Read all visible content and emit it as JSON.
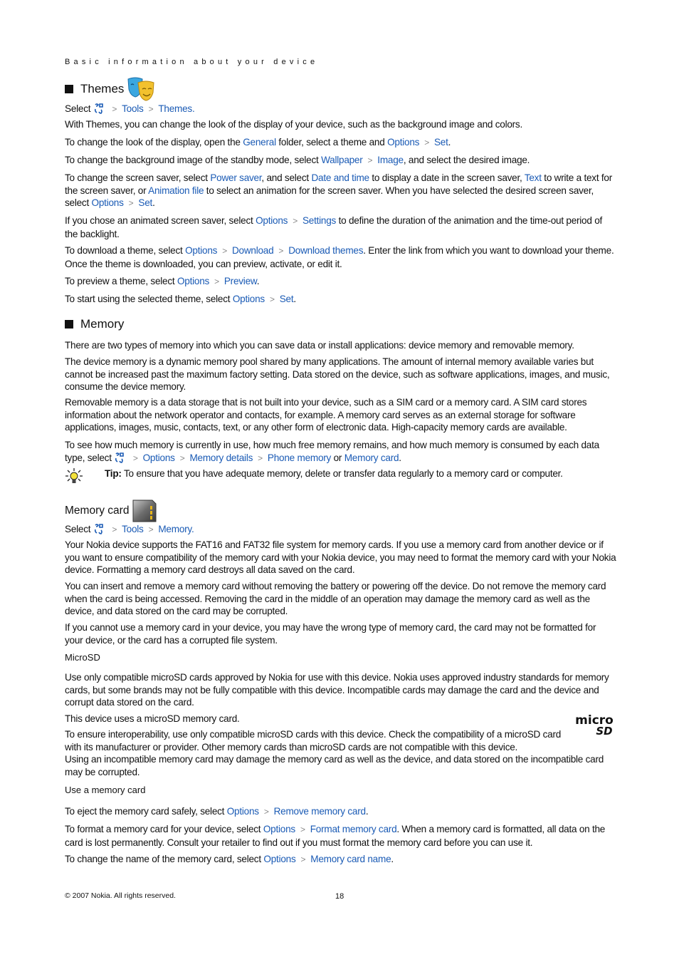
{
  "running_head": "Basic information about your device",
  "themes": {
    "heading": "Themes",
    "heading_icon": "theater-masks-icon",
    "path": {
      "prefix": "Select",
      "menu_icon": "menu-key-icon",
      "items": [
        "Tools",
        "Themes"
      ],
      "suffix": "."
    },
    "p1": "With Themes, you can change the look of the display of your device, such as the background image and colors.",
    "p2": {
      "a": "To change the look of the display, open the ",
      "link1": "General",
      "b": " folder, select a theme and ",
      "link2": "Options",
      "link3": "Set",
      "c": "."
    },
    "p3": {
      "a": "To change the background image of the standby mode, select ",
      "link1": "Wallpaper",
      "link2": "Image",
      "b": ", and select the desired image."
    },
    "p4": {
      "a": "To change the screen saver, select ",
      "link1": "Power saver",
      "b": ", and select ",
      "link2": "Date and time",
      "c": " to display a date in the screen saver, ",
      "link3": "Text",
      "d": " to write a text for the screen saver, or ",
      "link4": "Animation file",
      "e": " to select an animation for the screen saver. When you have selected the desired screen saver, select ",
      "link5": "Options",
      "link6": "Set",
      "f": "."
    },
    "p5": {
      "a": "If you chose an animated screen saver, select ",
      "link1": "Options",
      "link2": "Settings",
      "b": " to define the duration of the animation and the time-out period of the backlight."
    },
    "p6": {
      "a": "To download a theme, select ",
      "link1": "Options",
      "link2": "Download",
      "link3": "Download themes",
      "b": ". Enter the link from which you want to download your theme. Once the theme is downloaded, you can preview, activate, or edit it."
    },
    "p7": {
      "a": "To preview a theme, select ",
      "link1": "Options",
      "link2": "Preview",
      "b": "."
    },
    "p8": {
      "a": "To start using the selected theme, select ",
      "link1": "Options",
      "link2": "Set",
      "b": "."
    }
  },
  "memory": {
    "heading": "Memory",
    "p1": "There are two types of memory into which you can save data or install applications: device memory and removable memory.",
    "p2": "The device memory is a dynamic memory pool shared by many applications. The amount of internal memory available varies but cannot be increased past the maximum factory setting. Data stored on the device, such as software applications, images, and music, consume the device memory.",
    "p3": "Removable memory is a data storage that is not built into your device, such as a SIM card or a memory card. A SIM card stores information about the network operator and contacts, for example. A memory card serves as an external storage for software applications, images, music, contacts, text, or any other form of electronic data. High-capacity memory cards are available.",
    "p4": {
      "a": "To see how much memory is currently in use, how much free memory remains, and how much memory is consumed by each data type, select ",
      "link1": "Options",
      "link2": "Memory details",
      "link3": "Phone memory",
      "b": " or ",
      "link4": "Memory card",
      "c": "."
    },
    "tip": {
      "label": "Tip:",
      "text": " To ensure that you have adequate memory, delete or transfer data regularly to a memory card or computer."
    }
  },
  "memory_card": {
    "heading": "Memory card",
    "heading_icon": "memory-card-icon",
    "path": {
      "prefix": "Select",
      "items": [
        "Tools",
        "Memory"
      ],
      "suffix": "."
    },
    "p1": "Your Nokia device supports the FAT16 and FAT32 file system for memory cards. If you use a memory card from another device or if you want to ensure compatibility of the memory card with your Nokia device, you may need to format the memory card with your Nokia device. Formatting a memory card destroys all data saved on the card.",
    "p2": "You can insert and remove a memory card without removing the battery or powering off the device. Do not remove the memory card when the card is being accessed. Removing the card in the middle of an operation may damage the memory card as well as the device, and data stored on the card may be corrupted.",
    "p3": "If you cannot use a memory card in your device, you may have the wrong type of memory card, the card may not be formatted for your device, or the card has a corrupted file system.",
    "microsd": {
      "heading": "MicroSD",
      "p1": "Use only compatible microSD cards approved by Nokia for use with this device. Nokia uses approved industry standards for memory cards, but some brands may not be fully compatible with this device. Incompatible cards may damage the card and the device and corrupt data stored on the card.",
      "p2": "This device uses a microSD memory card.",
      "p3": "To ensure interoperability, use only compatible microSD cards with this device. Check the compatibility of a microSD card with its manufacturer or provider. Other memory cards than microSD cards are not compatible with this device.",
      "p4": "Using an incompatible memory card may damage the memory card as well as the device, and data stored on the incompatible card may be corrupted.",
      "logo_text_top": "micro",
      "logo_text_bottom": "SD"
    },
    "use": {
      "heading": "Use a memory card",
      "p1": {
        "a": "To eject the memory card safely, select ",
        "link1": "Options",
        "link2": "Remove memory card",
        "b": "."
      },
      "p2": {
        "a": "To format a memory card for your device, select ",
        "link1": "Options",
        "link2": "Format memory card",
        "b": ". When a memory card is formatted, all data on the card is lost permanently. Consult your retailer to find out if you must format the memory card before you can use it."
      },
      "p3": {
        "a": "To change the name of the memory card, select ",
        "link1": "Options",
        "link2": "Memory card name",
        "b": "."
      }
    }
  },
  "footer": {
    "copyright": "© 2007 Nokia. All rights reserved.",
    "page_number": "18"
  },
  "separator": ">"
}
